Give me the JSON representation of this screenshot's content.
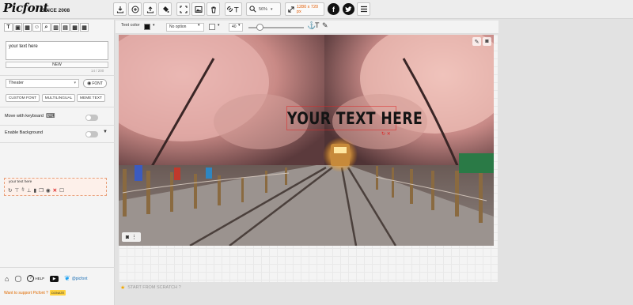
{
  "app": {
    "logo": "Picfont",
    "since": "SINCE 2008"
  },
  "toolbar": {
    "zoom_value": "56%",
    "canvas_size": "1280 x 720 px",
    "icons": [
      "download-icon",
      "add-icon",
      "upload-icon",
      "fill-icon",
      "fullscreen-icon",
      "image-icon",
      "trash-icon",
      "link-text-icon",
      "zoom-icon",
      "resize-icon",
      "facebook-icon",
      "twitter-icon",
      "menu-icon"
    ]
  },
  "tools": [
    "T",
    "▣",
    "▦",
    "☺",
    "⌕",
    "▥",
    "▤",
    "▩",
    "▦"
  ],
  "text_input": {
    "value": "your text here",
    "new_label": "NEW",
    "counter": "14 / 200"
  },
  "font": {
    "selected": "Theater",
    "font_button": "FONT"
  },
  "buttons": {
    "custom_font": "CUSTOM FONT",
    "multilingual": "MULTILINGUAL",
    "meme_text": "MEME TEXT"
  },
  "toggles": {
    "move_keyboard": "Move with keyboard",
    "enable_background": "Enable Background"
  },
  "layer": {
    "name": "your text here"
  },
  "footer": {
    "help": "HELP",
    "twitter": "@picfont",
    "support": "Want to support Picfont ?",
    "donate": "DONATE"
  },
  "options": {
    "text_color": "Text color",
    "bg_option": "No option",
    "size": "40"
  },
  "canvas": {
    "overlay_text": "YOUR TEXT HERE",
    "start_scratch": "START FROM SCRATCH ?"
  },
  "colors": {
    "accent": "#e05a00",
    "text_color": "#141414"
  }
}
